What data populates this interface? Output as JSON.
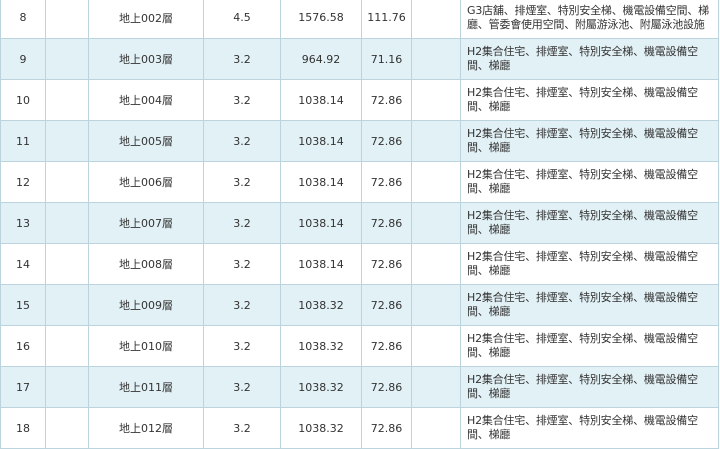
{
  "rows": [
    {
      "no": "8",
      "floor": "地上002層",
      "height": "4.5",
      "area": "1576.58",
      "ratio": "111.76",
      "use": "G3店舖、排煙室、特別安全梯、機電設備空間、梯廳、管委會使用空間、附屬游泳池、附屬泳池設施"
    },
    {
      "no": "9",
      "floor": "地上003層",
      "height": "3.2",
      "area": "964.92",
      "ratio": "71.16",
      "use": "H2集合住宅、排煙室、特別安全梯、機電設備空間、梯廳"
    },
    {
      "no": "10",
      "floor": "地上004層",
      "height": "3.2",
      "area": "1038.14",
      "ratio": "72.86",
      "use": "H2集合住宅、排煙室、特別安全梯、機電設備空間、梯廳"
    },
    {
      "no": "11",
      "floor": "地上005層",
      "height": "3.2",
      "area": "1038.14",
      "ratio": "72.86",
      "use": "H2集合住宅、排煙室、特別安全梯、機電設備空間、梯廳"
    },
    {
      "no": "12",
      "floor": "地上006層",
      "height": "3.2",
      "area": "1038.14",
      "ratio": "72.86",
      "use": "H2集合住宅、排煙室、特別安全梯、機電設備空間、梯廳"
    },
    {
      "no": "13",
      "floor": "地上007層",
      "height": "3.2",
      "area": "1038.14",
      "ratio": "72.86",
      "use": "H2集合住宅、排煙室、特別安全梯、機電設備空間、梯廳"
    },
    {
      "no": "14",
      "floor": "地上008層",
      "height": "3.2",
      "area": "1038.14",
      "ratio": "72.86",
      "use": "H2集合住宅、排煙室、特別安全梯、機電設備空間、梯廳"
    },
    {
      "no": "15",
      "floor": "地上009層",
      "height": "3.2",
      "area": "1038.32",
      "ratio": "72.86",
      "use": "H2集合住宅、排煙室、特別安全梯、機電設備空間、梯廳"
    },
    {
      "no": "16",
      "floor": "地上010層",
      "height": "3.2",
      "area": "1038.32",
      "ratio": "72.86",
      "use": "H2集合住宅、排煙室、特別安全梯、機電設備空間、梯廳"
    },
    {
      "no": "17",
      "floor": "地上011層",
      "height": "3.2",
      "area": "1038.32",
      "ratio": "72.86",
      "use": "H2集合住宅、排煙室、特別安全梯、機電設備空間、梯廳"
    },
    {
      "no": "18",
      "floor": "地上012層",
      "height": "3.2",
      "area": "1038.32",
      "ratio": "72.86",
      "use": "H2集合住宅、排煙室、特別安全梯、機電設備空間、梯廳"
    }
  ]
}
